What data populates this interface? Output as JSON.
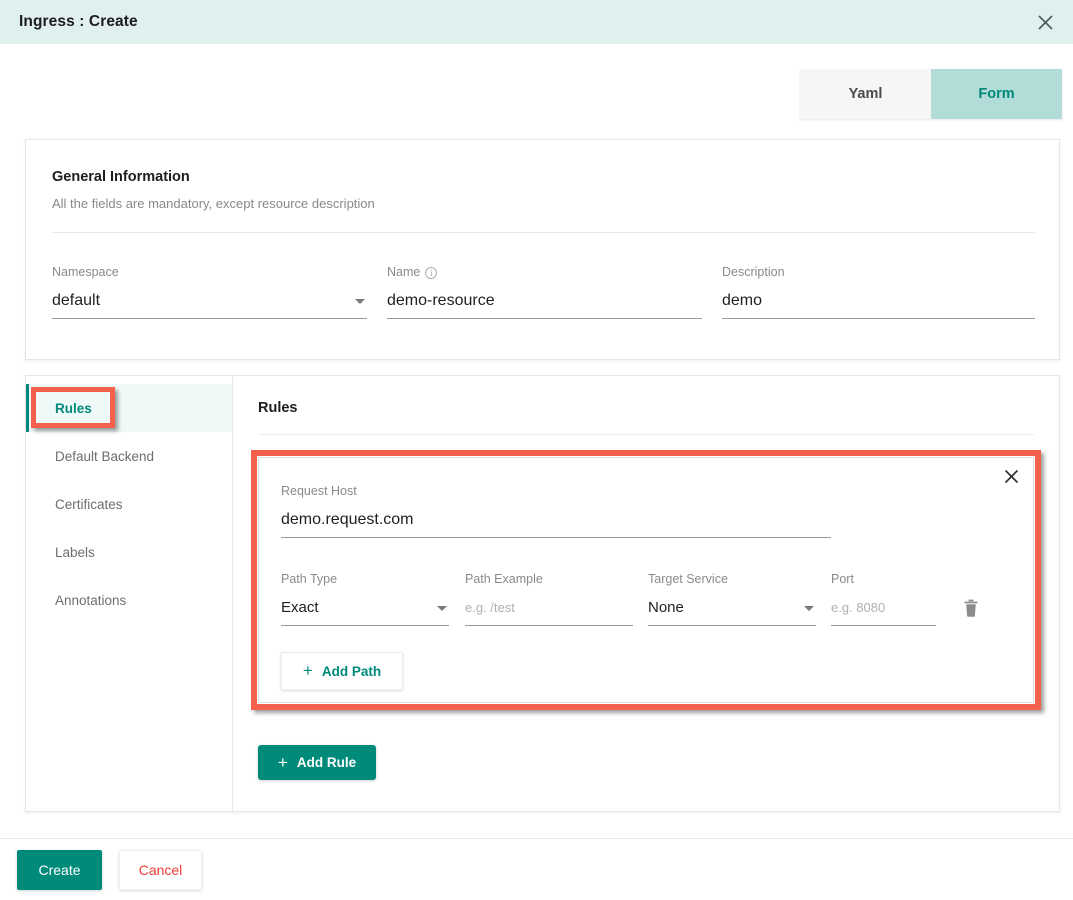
{
  "window": {
    "title": "Ingress : Create",
    "close_icon": "close-icon"
  },
  "tabs": [
    {
      "label": "Yaml",
      "active": false
    },
    {
      "label": "Form",
      "active": true
    }
  ],
  "general": {
    "title": "General Information",
    "subtitle": "All the fields are mandatory, except resource description",
    "fields": {
      "namespace": {
        "label": "Namespace",
        "value": "default",
        "type": "select"
      },
      "name": {
        "label": "Name",
        "value": "demo-resource",
        "type": "text",
        "info_icon": "info-icon"
      },
      "description": {
        "label": "Description",
        "value": "demo",
        "type": "text"
      }
    }
  },
  "sidebar": {
    "items": [
      {
        "label": "Rules",
        "active": true
      },
      {
        "label": "Default Backend",
        "active": false
      },
      {
        "label": "Certificates",
        "active": false
      },
      {
        "label": "Labels",
        "active": false
      },
      {
        "label": "Annotations",
        "active": false
      }
    ]
  },
  "rules_panel": {
    "heading": "Rules",
    "rule": {
      "close_icon": "close-icon",
      "request_host": {
        "label": "Request Host",
        "value": "demo.request.com"
      },
      "path_type": {
        "label": "Path Type",
        "value": "Exact",
        "type": "select"
      },
      "path_example": {
        "label": "Path Example",
        "value": "",
        "placeholder": "e.g. /test"
      },
      "target_service": {
        "label": "Target Service",
        "value": "None",
        "type": "select"
      },
      "port": {
        "label": "Port",
        "value": "",
        "placeholder": "e.g. 8080"
      },
      "delete_icon": "trash-icon",
      "add_path_button": {
        "label": "Add Path",
        "icon": "plus-icon"
      }
    },
    "add_rule_button": {
      "label": "Add Rule",
      "icon": "plus-icon"
    }
  },
  "footer": {
    "create_label": "Create",
    "cancel_label": "Cancel"
  },
  "colors": {
    "accent_teal": "#008a7a",
    "tab_active_bg": "#b2dcd8",
    "titlebar_bg": "#e0f0ef",
    "cancel_red": "#ef3e36",
    "annotation_red": "#f4604c"
  }
}
